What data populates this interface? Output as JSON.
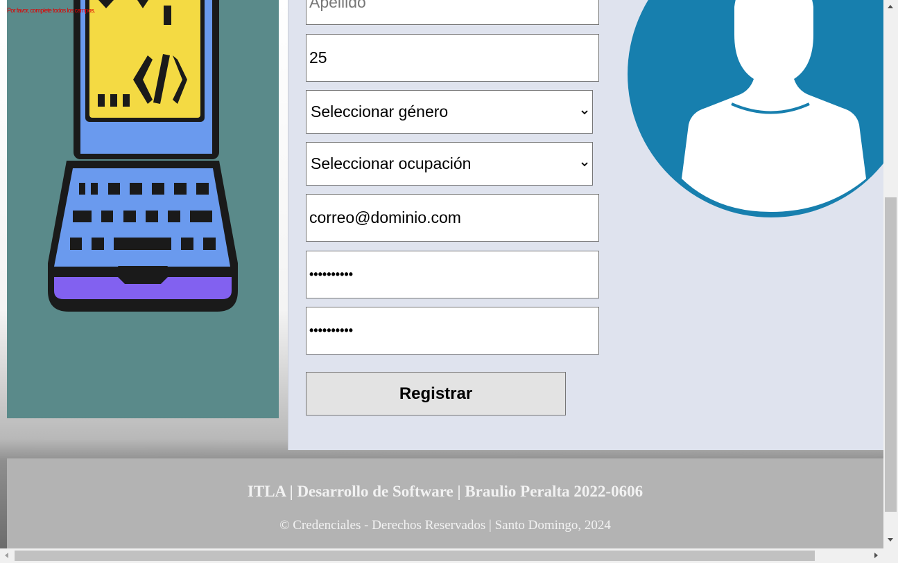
{
  "error": {
    "message": "Por favor, complete todos los campos."
  },
  "form": {
    "apellido_placeholder": "Apellido",
    "edad_value": "25",
    "genero_selected": "Seleccionar género",
    "ocupacion_selected": "Seleccionar ocupación",
    "email_value": "correo@dominio.com",
    "password_mask": "••••••••••",
    "confirm_mask": "••••••••••",
    "register_label": "Registrar"
  },
  "footer": {
    "line1": "ITLA | Desarrollo de Software | Braulio Peralta 2022-0606",
    "line2": "© Credenciales - Derechos Reservados | Santo Domingo, 2024"
  },
  "colors": {
    "left_panel_bg": "#5a8a8a",
    "form_panel_bg": "#dfe3ee",
    "avatar_blue": "#177fae",
    "footer_bg": "#b3b3b3",
    "error_red": "#e00000",
    "screen_yellow": "#f4da43",
    "laptop_blue": "#6a9aee",
    "keyboard_purple": "#8261f0"
  },
  "icons": {
    "illustration": "laptop-code-illustration",
    "avatar": "user-avatar-icon"
  }
}
